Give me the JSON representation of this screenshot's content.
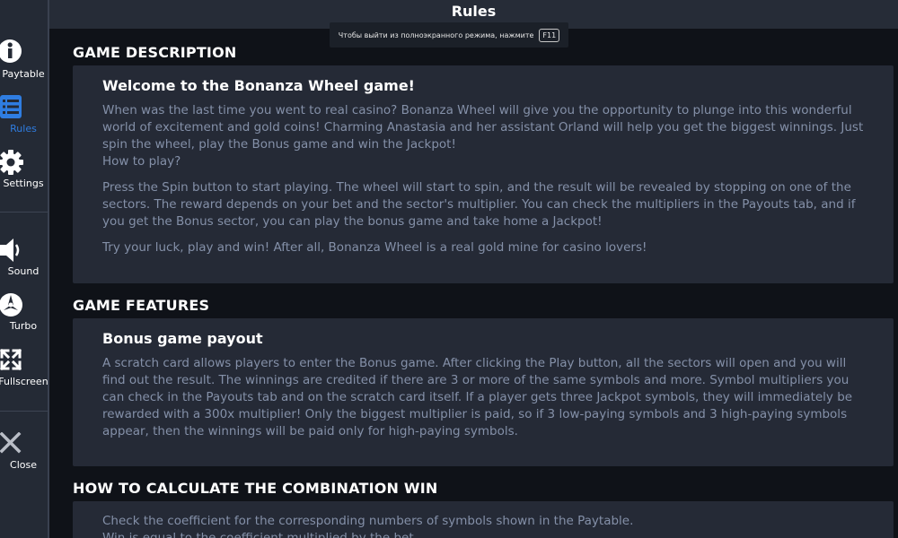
{
  "header": {
    "title": "Rules"
  },
  "fullscreen_hint": {
    "text": "Чтобы выйти из полноэкранного режима, нажмите",
    "key": "F11"
  },
  "sidebar": {
    "items": [
      {
        "label": "Paytable",
        "icon": "info-icon"
      },
      {
        "label": "Rules",
        "icon": "list-icon"
      },
      {
        "label": "Settings",
        "icon": "gear-icon"
      },
      {
        "label": "Sound",
        "icon": "speaker-icon"
      },
      {
        "label": "Turbo",
        "icon": "turbo-icon"
      },
      {
        "label": "Fullscreen",
        "icon": "expand-icon"
      },
      {
        "label": "Close",
        "icon": "close-icon"
      }
    ]
  },
  "colors": {
    "active": "#2f7de1",
    "text": "#8490a8",
    "card": "#252a36"
  },
  "sections": {
    "description": {
      "title": "GAME DESCRIPTION",
      "heading": "Welcome to the Bonanza Wheel game!",
      "p1": "When was the last time you went to real casino? Bonanza Wheel will give you the opportunity to plunge into this wonderful world of excitement and gold coins! Charming Anastasia and her assistant Orland will help you get the biggest winnings. Just spin the wheel, play the Bonus game and win the Jackpot!",
      "p1b": "How to play?",
      "p2": "Press the Spin button to start playing. The wheel will start to spin, and the result will be revealed by stopping on one of the sectors. The reward depends on your bet and the sector's multiplier. You can check the multipliers in the Payouts tab, and if you get the Bonus sector, you can play the bonus game and take home a Jackpot!",
      "p3": "Try your luck, play and win! After all, Bonanza Wheel is a real gold mine for casino lovers!"
    },
    "features": {
      "title": "GAME FEATURES",
      "heading": "Bonus game payout",
      "p1": "A scratch card allows players to enter the Bonus game. After clicking the Play button, all the sectors will open and you will find out the result. The winnings are credited if there are 3 or more of the same symbols and more. Symbol multipliers you can check in the Payouts tab and on the scratch card itself. If a player gets three Jackpot symbols, they will immediately be rewarded with a 300x multiplier! Only the biggest multiplier is paid, so if 3 low-paying symbols and 3 high-paying symbols appear, then the winnings will be paid only for high-paying symbols."
    },
    "combination": {
      "title": "HOW TO CALCULATE THE COMBINATION WIN",
      "p1": "Check the coefficient for the corresponding numbers of symbols shown in the Paytable.",
      "p2": "Win is equal to the coefficient multiplied by the bet."
    }
  }
}
